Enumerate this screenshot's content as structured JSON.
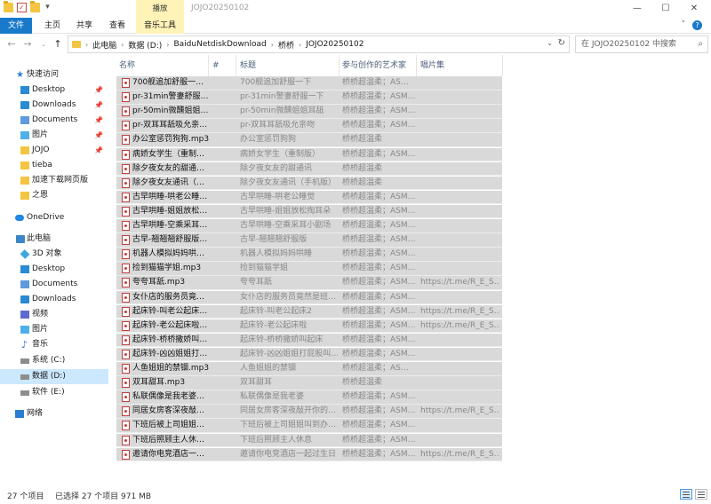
{
  "window": {
    "title": "JOJO20250102",
    "context_tab": "播放",
    "controls": {
      "minimize": "—",
      "maximize": "☐",
      "close": "✕"
    }
  },
  "ribbon": {
    "tabs": [
      "文件",
      "主页",
      "共享",
      "查看",
      "音乐工具"
    ],
    "expand": "˅"
  },
  "address": {
    "crumbs": [
      "此电脑",
      "数据 (D:)",
      "BaiduNetdiskDownload",
      "桥桥",
      "JOJO20250102"
    ],
    "search_placeholder": "在 JOJO20250102 中搜索"
  },
  "nav": {
    "quick_access": "快速访问",
    "quick_items": [
      "Desktop",
      "Downloads",
      "Documents",
      "图片",
      "JOJO",
      "tieba",
      "加速下载网页版",
      "之恩"
    ],
    "onedrive": "OneDrive",
    "this_pc": "此电脑",
    "pc_items": [
      "3D 对象",
      "Desktop",
      "Documents",
      "Downloads",
      "视频",
      "图片",
      "音乐",
      "系统 (C:)",
      "数据 (D:)",
      "软件 (E:)"
    ],
    "network": "网络"
  },
  "columns": [
    "名称",
    "#",
    "标题",
    "参与创作的艺术家",
    "唱片集"
  ],
  "files": [
    {
      "name": "700舰追加舒服一…",
      "title": "700舰追加舒服一下",
      "artist": "桥桥超温柔；AS…",
      "album": ""
    },
    {
      "name": "pr-31min警妻舒服…",
      "title": "pr-31min警妻舒服一下",
      "artist": "桥桥超温柔；ASM…",
      "album": ""
    },
    {
      "name": "pr-50min微醺姐姐…",
      "title": "pr-50min微醺姐姐耳舐",
      "artist": "桥桥超温柔；ASM…",
      "album": ""
    },
    {
      "name": "pr-双耳耳舐吸允亲…",
      "title": "pr-双耳耳舐吸允亲吻",
      "artist": "桥桥超温柔；ASM…",
      "album": ""
    },
    {
      "name": "办公室惩罚狗狗.mp3",
      "title": "办公室惩罚狗狗",
      "artist": "桥桥超温柔",
      "album": ""
    },
    {
      "name": "病娇女学生（重制…",
      "title": "病娇女学生（重制版）",
      "artist": "桥桥超温柔；ASM…",
      "album": ""
    },
    {
      "name": "除夕夜女友的甜通…",
      "title": "除夕夜女友的甜通讯",
      "artist": "桥桥超温柔",
      "album": ""
    },
    {
      "name": "除夕夜女友通讯（…",
      "title": "除夕夜女友通讯（手机版）",
      "artist": "桥桥超温柔",
      "album": ""
    },
    {
      "name": "古早哄睡-哄老公睡…",
      "title": "古早哄睡-哄老公睡觉",
      "artist": "桥桥超温柔；ASM…",
      "album": ""
    },
    {
      "name": "古早哄睡-姐姐放松…",
      "title": "古早哄睡-姐姐放松掏耳朵",
      "artist": "桥桥超温柔；ASM…",
      "album": ""
    },
    {
      "name": "古早哄睡-空乘采耳…",
      "title": "古早哄睡-空乘采耳小剧场",
      "artist": "桥桥超温柔；ASM…",
      "album": ""
    },
    {
      "name": "古早-翘翘翘舒服版…",
      "title": "古早-翘翘翘舒服版",
      "artist": "桥桥超温柔；ASM…",
      "album": ""
    },
    {
      "name": "机器人模拟妈妈哄…",
      "title": "机器人模拟妈妈哄睡",
      "artist": "桥桥超温柔；ASM…",
      "album": ""
    },
    {
      "name": "捡到猫猫学姐.mp3",
      "title": "捡到猫猫学姐",
      "artist": "桥桥超温柔；ASM…",
      "album": ""
    },
    {
      "name": "夸夸耳舐.mp3",
      "title": "夸夸耳舐",
      "artist": "桥桥超温柔；ASM…",
      "album": "https://t.me/R_E_S…"
    },
    {
      "name": "女仆店的服务员竟…",
      "title": "女仆店的服务员竟然是班…",
      "artist": "桥桥超温柔；ASM…",
      "album": ""
    },
    {
      "name": "起床铃-叫老公起床…",
      "title": "起床铃-叫老公起床2",
      "artist": "桥桥超温柔；ASM…",
      "album": "https://t.me/R_E_S…"
    },
    {
      "name": "起床铃-老公起床啦…",
      "title": "起床铃-老公起床啦",
      "artist": "桥桥超温柔；ASM…",
      "album": "https://t.me/R_E_S…"
    },
    {
      "name": "起床铃-桥桥撒娇叫…",
      "title": "起床铃-桥桥撒娇叫起床",
      "artist": "桥桥超温柔；ASM…",
      "album": ""
    },
    {
      "name": "起床铃-凶凶姐姐打…",
      "title": "起床铃-凶凶姐姐打屁股叫…",
      "artist": "桥桥超温柔；ASM…",
      "album": ""
    },
    {
      "name": "人鱼姐姐的禁锢.mp3",
      "title": "人鱼姐姐的禁锢",
      "artist": "桥桥超温柔；AS…",
      "album": ""
    },
    {
      "name": "双耳甜耳.mp3",
      "title": "双耳甜耳",
      "artist": "桥桥超温柔",
      "album": ""
    },
    {
      "name": "私联偶像是我老婆…",
      "title": "私联偶像是我老婆",
      "artist": "桥桥超温柔；ASM…",
      "album": ""
    },
    {
      "name": "同居女房客深夜敲…",
      "title": "同居女房客深夜敲开你的…",
      "artist": "桥桥超温柔；ASM…",
      "album": "https://t.me/R_E_S…"
    },
    {
      "name": "下班后被上司姐姐…",
      "title": "下班后被上司姐姐叫到办…",
      "artist": "桥桥超温柔；ASM…",
      "album": ""
    },
    {
      "name": "下班后照顾主人休…",
      "title": "下班后照顾主人休息",
      "artist": "桥桥超温柔；ASM…",
      "album": ""
    },
    {
      "name": "邀请你电竞酒店一…",
      "title": "邀请你电竞酒店一起过生日",
      "artist": "桥桥超温柔；ASM…",
      "album": "https://t.me/R_E_S…"
    }
  ],
  "status": {
    "count": "27 个项目",
    "selection": "已选择 27 个项目  971 MB"
  }
}
